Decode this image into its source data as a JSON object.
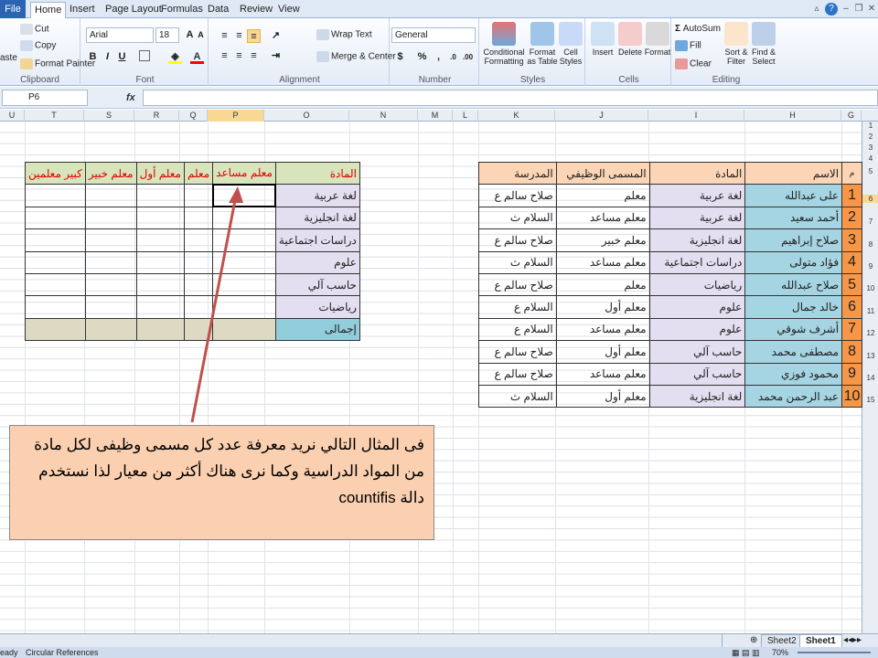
{
  "ribbon_tabs": [
    "File",
    "Home",
    "Insert",
    "Page Layout",
    "Formulas",
    "Data",
    "Review",
    "View"
  ],
  "clipboard": {
    "paste": "aste",
    "cut": "Cut",
    "copy": "Copy",
    "format_painter": "Format Painter",
    "label": "Clipboard"
  },
  "font": {
    "name": "Arial",
    "size": "18",
    "label": "Font",
    "bold": "B",
    "italic": "I",
    "underline": "U"
  },
  "alignment": {
    "wrap_text": "Wrap Text",
    "merge_center": "Merge & Center",
    "label": "Alignment"
  },
  "number": {
    "format": "General",
    "currency": "$",
    "percent": "%",
    "comma": ",",
    "label": "Number"
  },
  "styles": {
    "conditional": "Conditional Formatting",
    "format_table": "Format as Table",
    "cell_styles": "Cell Styles",
    "label": "Styles"
  },
  "cells": {
    "insert": "Insert",
    "delete": "Delete",
    "format": "Format",
    "label": "Cells"
  },
  "editing": {
    "autosum": "AutoSum",
    "fill": "Fill",
    "clear": "Clear",
    "sort_filter": "Sort & Filter",
    "find_select": "Find & Select",
    "label": "Editing"
  },
  "formula_bar": {
    "name_box": "P6",
    "fx": "fx",
    "content": ""
  },
  "columns": [
    {
      "name": "U"
    },
    {
      "name": "T"
    },
    {
      "name": "S"
    },
    {
      "name": "R"
    },
    {
      "name": "Q"
    },
    {
      "name": "P"
    },
    {
      "name": "O"
    },
    {
      "name": "N"
    },
    {
      "name": "M"
    },
    {
      "name": "L"
    },
    {
      "name": "K"
    },
    {
      "name": "J"
    },
    {
      "name": "I"
    },
    {
      "name": "H"
    },
    {
      "name": "G"
    }
  ],
  "rows": [
    "1",
    "2",
    "3",
    "4",
    "5",
    "6",
    "7",
    "8",
    "9",
    "10",
    "11",
    "12",
    "13",
    "14",
    "15"
  ],
  "left_table": {
    "headers": [
      "المادة",
      "معلم مساعد",
      "معلم",
      "معلم أول",
      "معلم خبير",
      "كبير معلمين"
    ],
    "subjects": [
      "لغة عربية",
      "لغة انجليزية",
      "دراسات اجتماعية",
      "علوم",
      "حاسب آلي",
      "رياضيات"
    ],
    "total": "إجمالى"
  },
  "right_table": {
    "headers": [
      "م",
      "الاسم",
      "المادة",
      "المسمى الوظيفي",
      "المدرسة"
    ],
    "rows": [
      [
        "1",
        "على عبدالله",
        "لغة عربية",
        "معلم",
        "صلاح سالم ع"
      ],
      [
        "2",
        "أحمد سعيد",
        "لغة عربية",
        "معلم مساعد",
        "السلام ث"
      ],
      [
        "3",
        "صلاح إبراهيم",
        "لغة انجليزية",
        "معلم خبير",
        "صلاح سالم ع"
      ],
      [
        "4",
        "فؤاد متولى",
        "دراسات اجتماعية",
        "معلم مساعد",
        "السلام ث"
      ],
      [
        "5",
        "صلاح عبدالله",
        "رياضيات",
        "معلم",
        "صلاح سالم ع"
      ],
      [
        "6",
        "خالد جمال",
        "علوم",
        "معلم أول",
        "السلام ع"
      ],
      [
        "7",
        "أشرف شوقي",
        "علوم",
        "معلم مساعد",
        "السلام ع"
      ],
      [
        "8",
        "مصطفى محمد",
        "حاسب آلي",
        "معلم أول",
        "صلاح سالم ع"
      ],
      [
        "9",
        "محمود فوزي",
        "حاسب آلي",
        "معلم مساعد",
        "صلاح سالم ع"
      ],
      [
        "10",
        "عبد الرحمن محمد",
        "لغة انجليزية",
        "معلم أول",
        "السلام ث"
      ]
    ]
  },
  "callout": {
    "text": "فى المثال التالي نريد معرفة عدد كل مسمى وظيفى لكل مادة من المواد الدراسية  وكما نرى هناك أكثر من معيار لذا نستخدم دالة countifis"
  },
  "sheet_tabs": [
    "Sheet2",
    "Sheet1"
  ],
  "status": {
    "ready": "eady",
    "circular": "Circular References",
    "zoom": "70%"
  },
  "colors": {
    "header_orange": "#fbd5b5",
    "subject_purple": "#e4dff0",
    "name_blue": "#a5d4e2",
    "num_orange": "#f79646",
    "total_blue": "#92cddc",
    "total_olive": "#ddd9c3",
    "header_green": "#d7e4bc",
    "red_text": "#e00000",
    "callout_bg": "#fbd0b0",
    "arrow": "#c0504d"
  }
}
